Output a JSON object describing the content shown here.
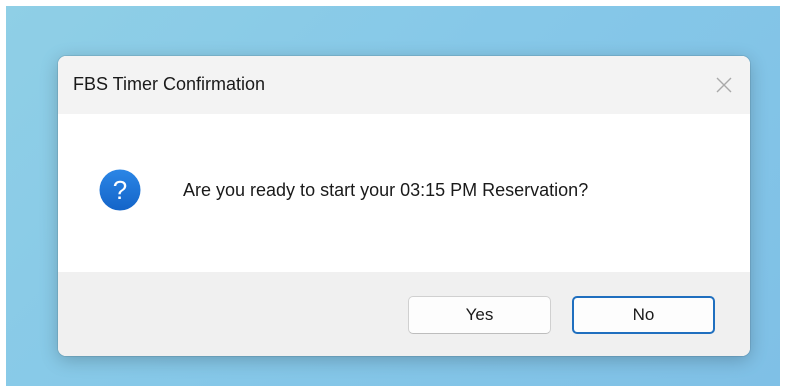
{
  "dialog": {
    "title": "FBS Timer Confirmation",
    "message": "Are you ready to start your 03:15 PM Reservation?",
    "icon": "question-icon",
    "close_icon": "close-icon",
    "buttons": {
      "yes_label": "Yes",
      "no_label": "No",
      "default": "No"
    }
  },
  "colors": {
    "desktop_background": "#86c8e8",
    "icon_blue": "#1e74d6",
    "default_button_border": "#1f6fbf",
    "footer_background": "#f0f0f0"
  }
}
